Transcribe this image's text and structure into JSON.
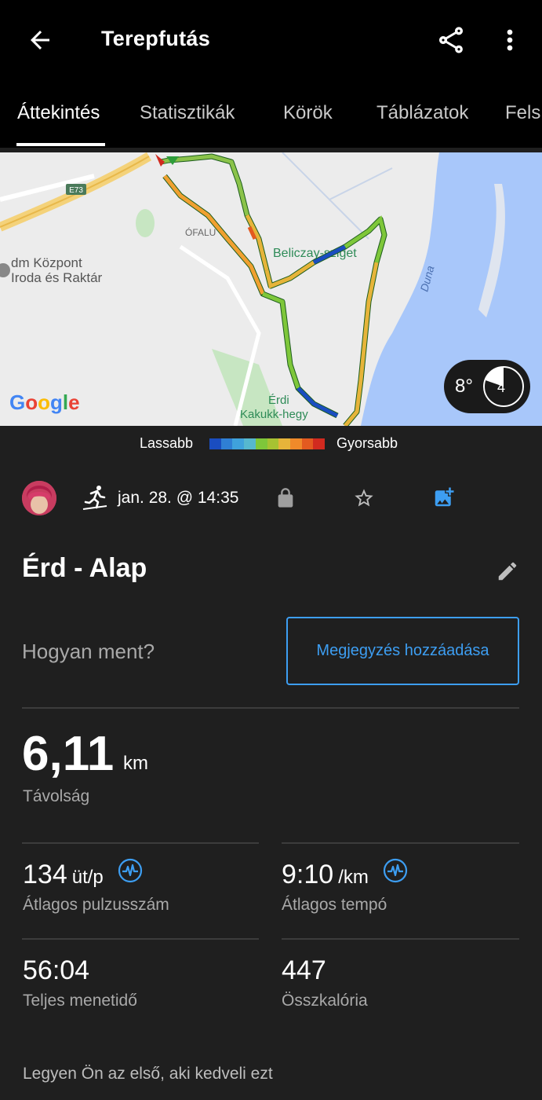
{
  "header": {
    "title": "Terepfutás"
  },
  "tabs": [
    {
      "label": "Áttekintés",
      "active": true
    },
    {
      "label": "Statisztikák"
    },
    {
      "label": "Körök"
    },
    {
      "label": "Táblázatok"
    },
    {
      "label": "Fels"
    }
  ],
  "map": {
    "road_label": "E73",
    "place_labels": [
      "ÓFALU",
      "dm Központ",
      "Iroda és Raktár",
      "Beliczay-sziget",
      "Duna",
      "Érdi",
      "Kakukk-hegy"
    ],
    "provider": "Google",
    "weather": {
      "temperature": "8°",
      "wind": "4"
    }
  },
  "pace_legend": {
    "slower": "Lassabb",
    "faster": "Gyorsabb",
    "colors": [
      "#1a4dc0",
      "#2f7fd4",
      "#3fa2dc",
      "#56b8cf",
      "#7ec73a",
      "#a7c232",
      "#e6b43a",
      "#f08a2a",
      "#e35a20",
      "#d12a1f"
    ]
  },
  "activity": {
    "date": "jan. 28. @ 14:35",
    "name": "Érd - Alap",
    "prompt": "Hogyan ment?",
    "add_note": "Megjegyzés hozzáadása"
  },
  "distance": {
    "value": "6,11",
    "unit": "km",
    "label": "Távolság"
  },
  "stats": {
    "avg_hr": {
      "value": "134",
      "unit": "üt/p",
      "label": "Átlagos pulzusszám"
    },
    "avg_pace": {
      "value": "9:10",
      "unit": "/km",
      "label": "Átlagos tempó"
    },
    "total_time": {
      "value": "56:04",
      "label": "Teljes menetidő"
    },
    "calories": {
      "value": "447",
      "label": "Összkalória"
    }
  },
  "likes_text": "Legyen Ön az első, aki kedveli ezt",
  "colors": {
    "accent": "#3d9ef2",
    "background": "#1f1f1f",
    "header": "#000000"
  }
}
